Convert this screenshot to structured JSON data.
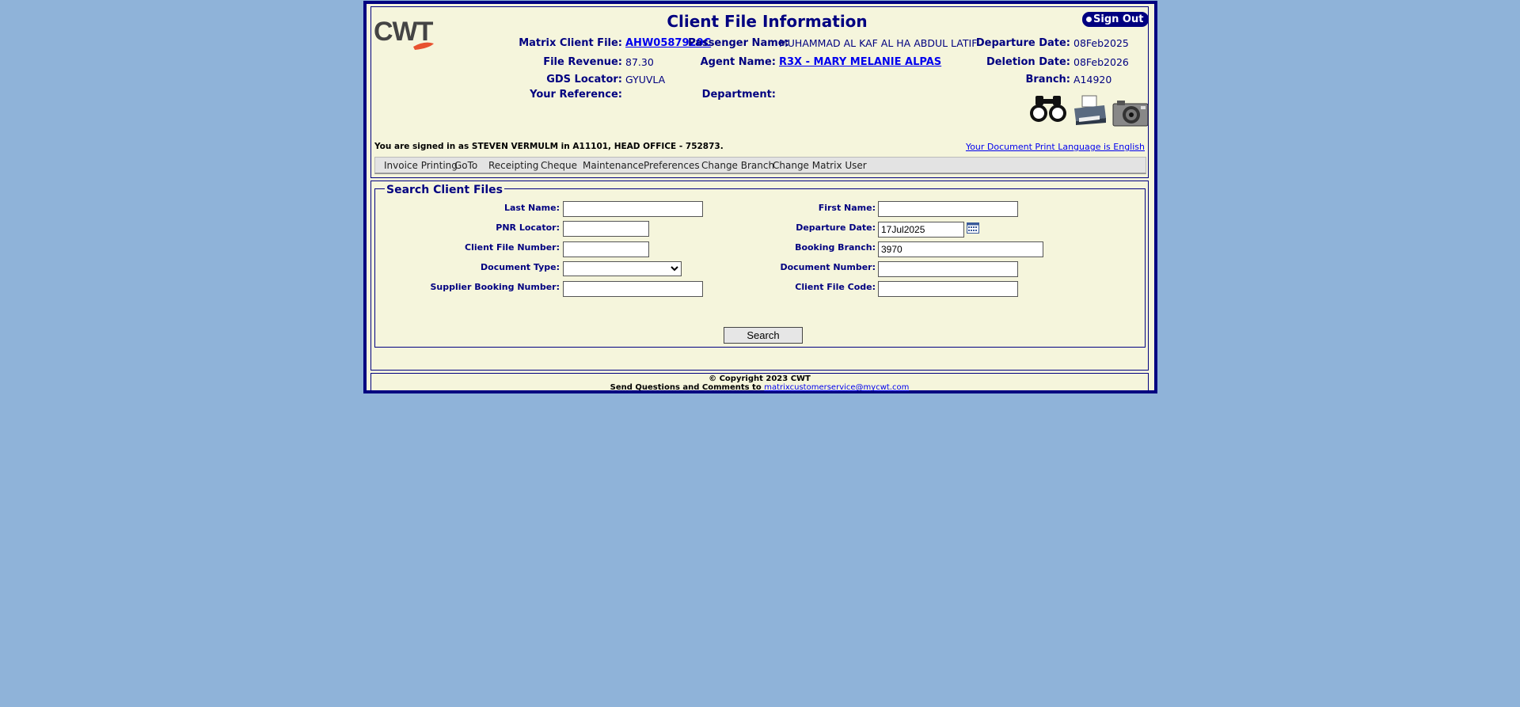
{
  "header": {
    "logo_text": "CWT",
    "title": "Client File Information",
    "signout_label": "Sign Out",
    "matrix_client_file_label": "Matrix Client File:",
    "matrix_client_file_value": "AHW0587920C",
    "passenger_name_label": "Passenger Name:",
    "passenger_name_value": "MUHAMMAD AL KAF AL HA ABDUL LATIF",
    "departure_date_label": "Departure Date:",
    "departure_date_value": "08Feb2025",
    "file_revenue_label": "File Revenue:",
    "file_revenue_value": "87.30",
    "agent_name_label": "Agent Name:",
    "agent_name_value": "R3X - MARY MELANIE ALPAS",
    "deletion_date_label": "Deletion Date:",
    "deletion_date_value": "08Feb2026",
    "gds_locator_label": "GDS Locator:",
    "gds_locator_value": "GYUVLA",
    "branch_label": "Branch:",
    "branch_value": "A14920",
    "your_reference_label": "Your Reference:",
    "department_label": "Department:",
    "signed_in_text": "You are signed in as STEVEN VERMULM in A11101, HEAD OFFICE - 752873.",
    "print_language_link": "Your Document Print Language is English",
    "icons": [
      "binoculars-icon",
      "printer-icon",
      "camera-icon"
    ]
  },
  "menu": {
    "items": [
      "Invoice Printing",
      "GoTo",
      "Receipting",
      "Cheque",
      "Maintenance",
      "Preferences",
      "Change Branch",
      "Change Matrix User"
    ]
  },
  "search": {
    "legend": "Search Client Files",
    "last_name_label": "Last Name:",
    "last_name_value": "",
    "first_name_label": "First Name:",
    "first_name_value": "",
    "pnr_locator_label": "PNR Locator:",
    "pnr_locator_value": "",
    "departure_date_label": "Departure Date:",
    "departure_date_value": "17Jul2025",
    "client_file_number_label": "Client File Number:",
    "client_file_number_value": "",
    "booking_branch_label": "Booking Branch:",
    "booking_branch_value": "3970",
    "document_type_label": "Document Type:",
    "document_type_value": "",
    "document_number_label": "Document Number:",
    "document_number_value": "",
    "supplier_booking_number_label": "Supplier Booking Number:",
    "supplier_booking_number_value": "",
    "client_file_code_label": "Client File Code:",
    "client_file_code_value": "",
    "search_button_label": "Search"
  },
  "footer": {
    "copyright": "© Copyright 2023 CWT",
    "questions_text": "Send Questions and Comments to",
    "email": "matrixcustomerservice@mycwt.com"
  },
  "colors": {
    "page_background": "#8fb3d9",
    "panel_background": "#f5f5dc",
    "navy": "#000080",
    "logo_red": "#e8522f"
  }
}
